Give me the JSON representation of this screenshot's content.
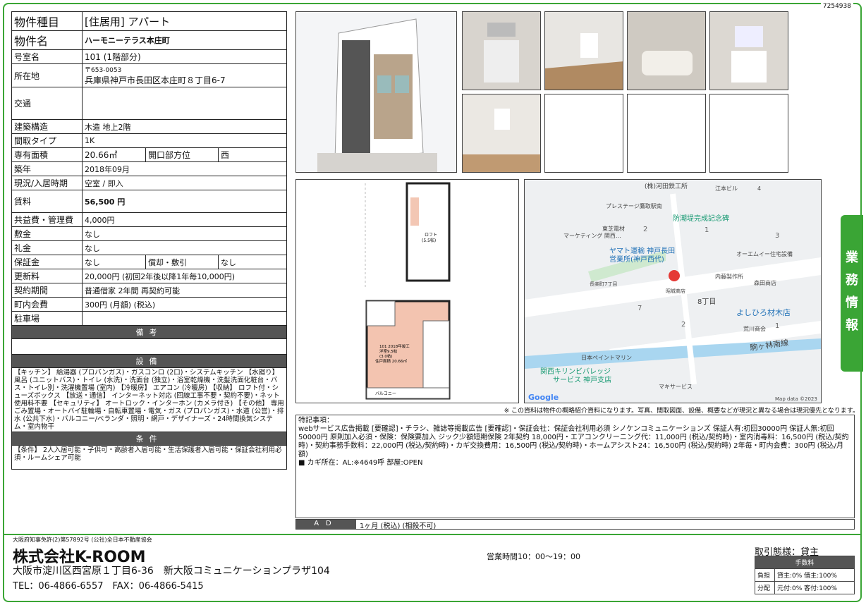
{
  "doc_id": "7254938",
  "props": {
    "type_label": "物件種目",
    "type_value": "[住居用] アパート",
    "name_label": "物件名",
    "name_value": "ハーモニーテラス本庄町",
    "room_label": "号室名",
    "room_value": "101 (1階部分)",
    "addr_label": "所在地",
    "addr_zip": "〒653-0053",
    "addr_value": "兵庫県神戸市長田区本庄町８丁目6-7",
    "access_label": "交通",
    "structure_label": "建築構造",
    "structure_value": "木造 地上2階",
    "layout_label": "間取タイプ",
    "layout_value": "1K",
    "area_label": "専有面積",
    "area_value": "20.66㎡",
    "facing_label": "開口部方位",
    "facing_value": "西",
    "built_label": "築年",
    "built_value": "2018年09月",
    "status_label": "現況/入居時期",
    "status_value": "空室 / 即入",
    "rent_label": "賃料",
    "rent_value": "56,500 円",
    "mgmt_label": "共益費・管理費",
    "mgmt_value": "4,000円",
    "deposit_label": "敷金",
    "deposit_value": "なし",
    "keymoney_label": "礼金",
    "keymoney_value": "なし",
    "guarantee_label": "保証金",
    "guarantee_value": "なし",
    "amort_label": "償却・敷引",
    "amort_value": "なし",
    "renewal_label": "更新料",
    "renewal_value": "20,000円 (初回2年後以降1年毎10,000円)",
    "contract_label": "契約期間",
    "contract_value": "普通借家 2年間 再契約可能",
    "assoc_label": "町内会費",
    "assoc_value": "300円 (月額) (税込)",
    "parking_label": "駐車場",
    "biko_label": "備考",
    "setsubi_label": "設備",
    "setsubi_text": "【キッチン】 給湯器 (プロパンガス)・ガスコンロ (2口)・システムキッチン 【水廻り】 風呂 (ユニットバス)・トイレ (水洗)・洗面台 (独立)・浴室乾燥機・洗髪洗面化粧台・バス・トイレ別・洗濯機置場 (室内) 【冷暖房】 エアコン (冷暖房) 【収納】 ロフト付・シューズボックス 【放送・通信】 インターネット対応 (回線工事不要・契約不要)・ネット使用料不要 【セキュリティ】 オートロック・インターホン (カメラ付き) 【その他】 専用ごみ置場・オートバイ駐輪場・自転車置場・電気・ガス (プロパンガス)・水道 (公営)・排水 (公共下水)・バルコニー/ベランダ・照明・網戸・デザイナーズ・24時間換気システム・室内物干",
    "joken_label": "条件",
    "joken_text": "【条件】 2人入居可能・子供可・高齢者入居可能・生活保護者入居可能・保証会社利用必須・ルームシェア可能"
  },
  "plan": {
    "loft": "ロフト\n(5.5帖)",
    "room": "101 2018年竣工\n洋室9.5帖\n(3.0帖)\n住戸面積 20.66㎡",
    "balcony": "バルコニー"
  },
  "map": {
    "labels": [
      "(株)河田鉄工所",
      "江本ビル",
      "4",
      "プレステージ鷹取駅南",
      "防潮堤完成記念碑",
      "東芝電材",
      "マーケティング 関西...",
      "2",
      "1",
      "3",
      "ヤマト運輸 神戸長田",
      "営業所(神戸西代)",
      "オーエムイー住宅設備",
      "内藤製作所",
      "長楽町7丁目",
      "森田商店",
      "昭城商店",
      "8丁目",
      "7",
      "よしひろ材木店",
      "2",
      "荒川商会",
      "1",
      "駒ヶ林南線",
      "日本ペイントマリン",
      "関西キリンビバレッジ",
      "サービス 神戸支店",
      "マキサービス"
    ],
    "google": "Google",
    "mapdata": "Map data ©2023"
  },
  "note": "※ この資料は物件の概略紹介資料になります。写真、間取図面、設備、概要などが現況と異なる場合は現況優先となります。",
  "remarks": {
    "title": "特記事項：",
    "body": "webサービス広告掲載 [要確認]・チラシ、雑誌等掲載広告 [要確認]・保証会社：保証会社利用必須 シノケンコミュニケーションズ 保証人有:初回30000円 保証人無:初回50000円 原則加入必須・保険：保険要加入 ジック少額短期保険 2年契約 18,000円・エアコンクリーニング代：11,000円 (税込/契約時)・室内消毒料：16,500円 (税込/契約時)・契約事務手数料：22,000円 (税込/契約時)・カギ交換費用：16,500円 (税込/契約時)・ホームアシスト24：16,500円 (税込/契約時) 2年毎・町内会費：300円 (税込/月額)",
    "key": "■ カギ所在：AL:※4649呼 部屋:OPEN"
  },
  "ad": {
    "label": "AD",
    "value": "1ヶ月 (税込) (相殺不可)"
  },
  "side_tab": "業務情報",
  "footer": {
    "license": "大阪府知事免許(2)第57892号 (公社)全日本不動産協会",
    "company": "株式会社K-ROOM",
    "address": "大阪市淀川区西宮原１丁目6-36　新大阪コミュニケーションプラザ104",
    "tel": "TEL：06-4866-6557　FAX：06-4866-5415",
    "hours": "営業時間10：00〜19：00",
    "torihiki": "取引態様：貸主",
    "fee_header": "手数料",
    "fee_row1_label": "負担",
    "fee_row1_value": "貸主:0% 借主:100%",
    "fee_row2_label": "分配",
    "fee_row2_value": "元付:0% 客付:100%"
  }
}
